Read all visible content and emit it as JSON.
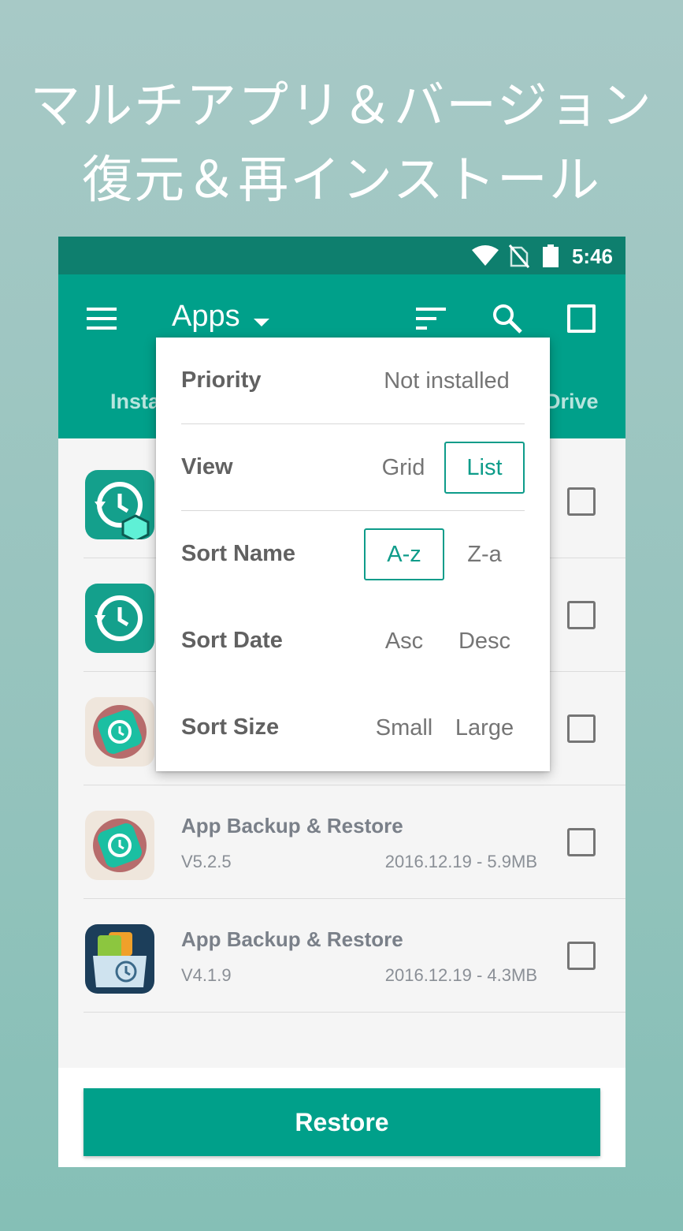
{
  "headline": {
    "line1": "マルチアプリ＆バージョン",
    "line2": "復元＆再インストール"
  },
  "statusbar": {
    "time": "5:46",
    "icons": [
      "wifi-icon",
      "no-sim-icon",
      "battery-icon"
    ]
  },
  "toolbar": {
    "title": "Apps",
    "icons": [
      "menu-icon",
      "sort-icon",
      "search-icon",
      "select-all-checkbox"
    ],
    "tabs": [
      "Insta",
      "Drive"
    ]
  },
  "dropdown": {
    "priority": {
      "label": "Priority",
      "option": "Not installed"
    },
    "view": {
      "label": "View",
      "options": [
        "Grid",
        "List"
      ],
      "selected": "List"
    },
    "sort_name": {
      "label": "Sort Name",
      "options": [
        "A-z",
        "Z-a"
      ],
      "selected": "A-z"
    },
    "sort_date": {
      "label": "Sort Date",
      "options": [
        "Asc",
        "Desc"
      ]
    },
    "sort_size": {
      "label": "Sort Size",
      "options": [
        "Small",
        "Large"
      ]
    }
  },
  "list": {
    "rows": [
      {
        "name": "",
        "version": "",
        "meta": "",
        "icon": "restore-cube-icon"
      },
      {
        "name": "",
        "version": "",
        "meta": "",
        "icon": "restore-icon"
      },
      {
        "name": "",
        "version": "",
        "meta": "",
        "icon": "restore-flower-icon"
      },
      {
        "name": "App Backup & Restore",
        "version": "V5.2.5",
        "meta": "2016.12.19 - 5.9MB",
        "icon": "restore-flower-icon"
      },
      {
        "name": "App Backup & Restore",
        "version": "V4.1.9",
        "meta": "2016.12.19 - 4.3MB",
        "icon": "backup-folder-icon"
      }
    ]
  },
  "restore_button": "Restore",
  "colors": {
    "accent": "#00a08a",
    "statusbar": "#0e7f6e",
    "background": "#95c3bd"
  }
}
